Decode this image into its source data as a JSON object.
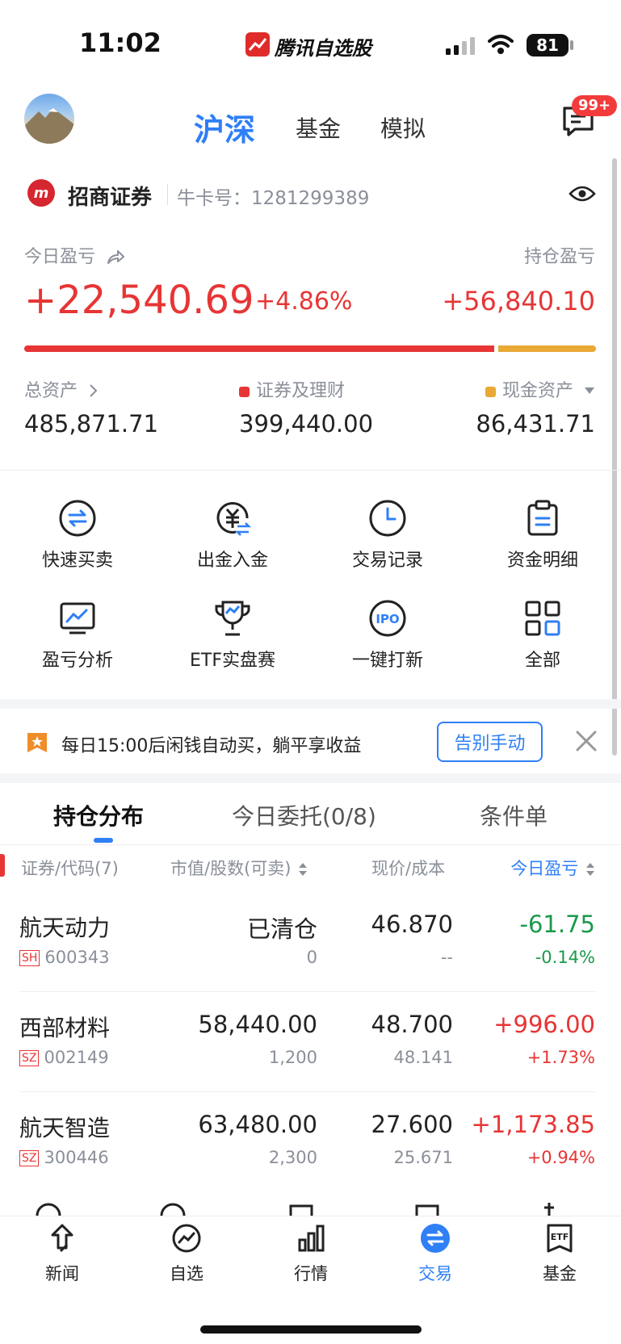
{
  "status_bar": {
    "time": "11:02",
    "app_name": "腾讯自选股",
    "battery": "81"
  },
  "header": {
    "tabs": [
      "沪深",
      "基金",
      "模拟"
    ],
    "active_tab": "沪深",
    "message_badge": "99+"
  },
  "broker": {
    "logo_text": "m",
    "name": "招商证券",
    "account_label": "牛卡号：",
    "account_no": "1281299389"
  },
  "pnl": {
    "today_label": "今日盈亏",
    "hold_label": "持仓盈亏",
    "today_value": "+22,540.69",
    "today_pct": "+4.86%",
    "hold_value": "+56,840.10",
    "securities_share": 0.822
  },
  "assets": {
    "total_label": "总资产",
    "total_value": "485,871.71",
    "sec_label": "证券及理财",
    "sec_value": "399,440.00",
    "cash_label": "现金资产",
    "cash_value": "86,431.71"
  },
  "quick_actions": [
    {
      "label": "快速买卖",
      "icon": "swap-icon"
    },
    {
      "label": "出金入金",
      "icon": "yuan-transfer-icon"
    },
    {
      "label": "交易记录",
      "icon": "clock-icon"
    },
    {
      "label": "资金明细",
      "icon": "clipboard-icon"
    },
    {
      "label": "盈亏分析",
      "icon": "monitor-chart-icon"
    },
    {
      "label": "ETF实盘赛",
      "icon": "trophy-icon"
    },
    {
      "label": "一键打新",
      "icon": "ipo-icon"
    },
    {
      "label": "全部",
      "icon": "grid-icon"
    }
  ],
  "banner": {
    "text": "每日15:00后闲钱自动买，躺平享收益",
    "button": "告别手动"
  },
  "position_tabs": [
    "持仓分布",
    "今日委托(0/8)",
    "条件单"
  ],
  "table": {
    "headers": [
      "证券/代码(7)",
      "市值/股数(可卖)",
      "现价/成本",
      "今日盈亏"
    ],
    "rows": [
      {
        "name": "航天动力",
        "market": "SH",
        "code": "600343",
        "value": "已清仓",
        "shares": "0",
        "price": "46.870",
        "cost": "--",
        "pnl": "-61.75",
        "pnl_pct": "-0.14%",
        "dir": "neg"
      },
      {
        "name": "西部材料",
        "market": "SZ",
        "code": "002149",
        "value": "58,440.00",
        "shares": "1,200",
        "price": "48.700",
        "cost": "48.141",
        "pnl": "+996.00",
        "pnl_pct": "+1.73%",
        "dir": "pos"
      },
      {
        "name": "航天智造",
        "market": "SZ",
        "code": "300446",
        "value": "63,480.00",
        "shares": "2,300",
        "price": "27.600",
        "cost": "25.671",
        "pnl": "+1,173.85",
        "pnl_pct": "+0.94%",
        "dir": "pos"
      }
    ]
  },
  "bottom_nav": [
    {
      "label": "新闻",
      "icon": "news-icon"
    },
    {
      "label": "自选",
      "icon": "watchlist-icon"
    },
    {
      "label": "行情",
      "icon": "market-icon"
    },
    {
      "label": "交易",
      "icon": "trade-icon"
    },
    {
      "label": "基金",
      "icon": "etf-icon"
    }
  ],
  "active_nav": "交易",
  "colors": {
    "accent": "#2f7ff5",
    "up": "#e73535",
    "down": "#1a9a4a",
    "cash": "#e8a935"
  }
}
